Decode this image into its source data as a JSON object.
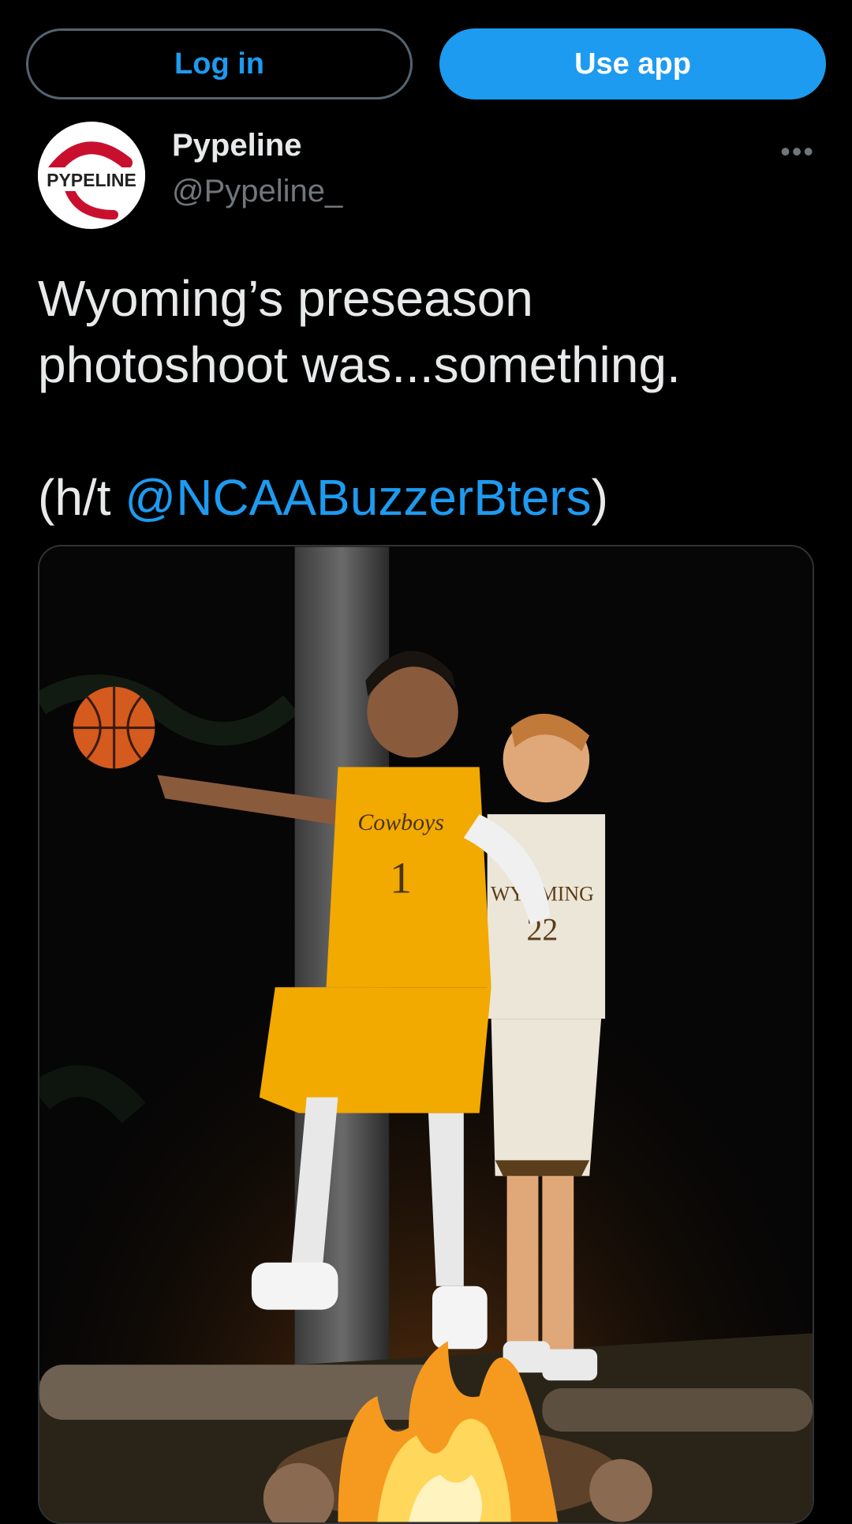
{
  "topbar": {
    "login_label": "Log in",
    "app_label": "Use app"
  },
  "tweet": {
    "author": {
      "name": "Pypeline",
      "handle": "@Pypeline_",
      "avatar_text": "PYPELINE"
    },
    "more_icon": "ellipsis-icon",
    "text_line1": "Wyoming’s preseason",
    "text_line2": "photoshoot was...something.",
    "credit_prefix": "(h/t ",
    "credit_mention": "@NCAABuzzerBters",
    "credit_suffix": ")",
    "photo": {
      "jersey1_text": "Cowboys",
      "jersey1_number": "1",
      "jersey2_text": "WYOMING",
      "jersey2_number": "22"
    }
  },
  "colors": {
    "accent": "#1d9bf0",
    "background": "#000000",
    "text": "#e7e9ea",
    "muted": "#71767b"
  }
}
